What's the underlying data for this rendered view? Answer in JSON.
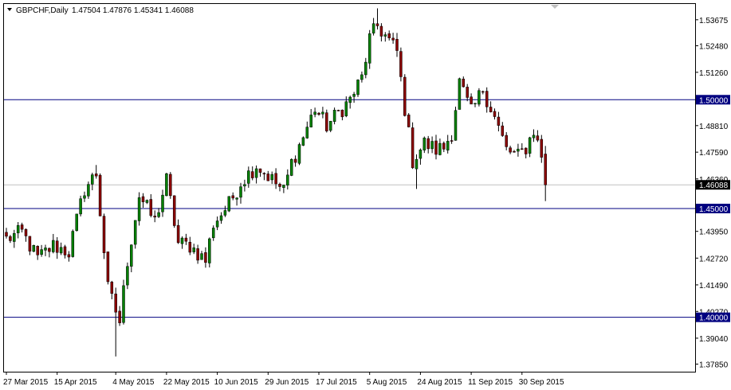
{
  "header": {
    "symbol": "GBPCHF,Daily",
    "ohlc": "1.47504 1.47876 1.45341 1.46088"
  },
  "chart_data": {
    "type": "candlestick",
    "ylim": [
      1.375,
      1.544
    ],
    "y_ticks": [
      1.53675,
      1.5248,
      1.5126,
      1.4881,
      1.4759,
      1.4636,
      1.4395,
      1.4272,
      1.4149,
      1.4027,
      1.3904,
      1.3785
    ],
    "y_tick_labels": [
      "1.53675",
      "1.52480",
      "1.51260",
      "1.48810",
      "1.47590",
      "1.46360",
      "1.43950",
      "1.42720",
      "1.41490",
      "1.40270",
      "1.39040",
      "1.37850"
    ],
    "x_ticks": [
      {
        "index": 0,
        "label": "27 Mar 2015"
      },
      {
        "index": 13,
        "label": "15 Apr 2015"
      },
      {
        "index": 28,
        "label": "4 May 2015"
      },
      {
        "index": 41,
        "label": "22 May 2015"
      },
      {
        "index": 54,
        "label": "10 Jun 2015"
      },
      {
        "index": 67,
        "label": "29 Jun 2015"
      },
      {
        "index": 80,
        "label": "17 Jul 2015"
      },
      {
        "index": 93,
        "label": "5 Aug 2015"
      },
      {
        "index": 106,
        "label": "24 Aug 2015"
      },
      {
        "index": 119,
        "label": "11 Sep 2015"
      },
      {
        "index": 132,
        "label": "30 Sep 2015"
      }
    ],
    "levels": [
      {
        "value": 1.5,
        "label": "1.50000",
        "color": "#000080"
      },
      {
        "value": 1.45,
        "label": "1.45000",
        "color": "#000080"
      },
      {
        "value": 1.4,
        "label": "1.40000",
        "color": "#000080"
      }
    ],
    "current": {
      "value": 1.46088,
      "label": "1.46088"
    },
    "colors": {
      "bull": "#008000",
      "bear": "#8b0000",
      "wick": "#000000",
      "level": "#000080",
      "current": "#c0c0c0"
    },
    "close_path": [
      [
        0,
        1.436
      ],
      [
        4,
        1.439
      ],
      [
        8,
        1.427
      ],
      [
        12,
        1.433
      ],
      [
        16,
        1.43
      ],
      [
        20,
        1.459
      ],
      [
        23,
        1.466
      ],
      [
        26,
        1.413
      ],
      [
        29,
        1.398
      ],
      [
        31,
        1.426
      ],
      [
        34,
        1.456
      ],
      [
        38,
        1.444
      ],
      [
        41,
        1.463
      ],
      [
        44,
        1.434
      ],
      [
        47,
        1.433
      ],
      [
        51,
        1.426
      ],
      [
        53,
        1.443
      ],
      [
        57,
        1.452
      ],
      [
        60,
        1.462
      ],
      [
        64,
        1.47
      ],
      [
        67,
        1.465
      ],
      [
        71,
        1.458
      ],
      [
        73,
        1.471
      ],
      [
        76,
        1.483
      ],
      [
        79,
        1.496
      ],
      [
        82,
        1.488
      ],
      [
        85,
        1.494
      ],
      [
        88,
        1.5
      ],
      [
        91,
        1.51
      ],
      [
        93,
        1.528
      ],
      [
        95,
        1.534
      ],
      [
        98,
        1.527
      ],
      [
        100,
        1.522
      ],
      [
        102,
        1.496
      ],
      [
        104,
        1.472
      ],
      [
        107,
        1.48
      ],
      [
        110,
        1.477
      ],
      [
        112,
        1.478
      ],
      [
        114,
        1.485
      ],
      [
        116,
        1.508
      ],
      [
        119,
        1.494
      ],
      [
        122,
        1.505
      ],
      [
        125,
        1.492
      ],
      [
        128,
        1.477
      ],
      [
        131,
        1.474
      ],
      [
        133,
        1.478
      ],
      [
        135,
        1.486
      ],
      [
        137,
        1.474
      ],
      [
        138,
        1.4609
      ]
    ]
  }
}
